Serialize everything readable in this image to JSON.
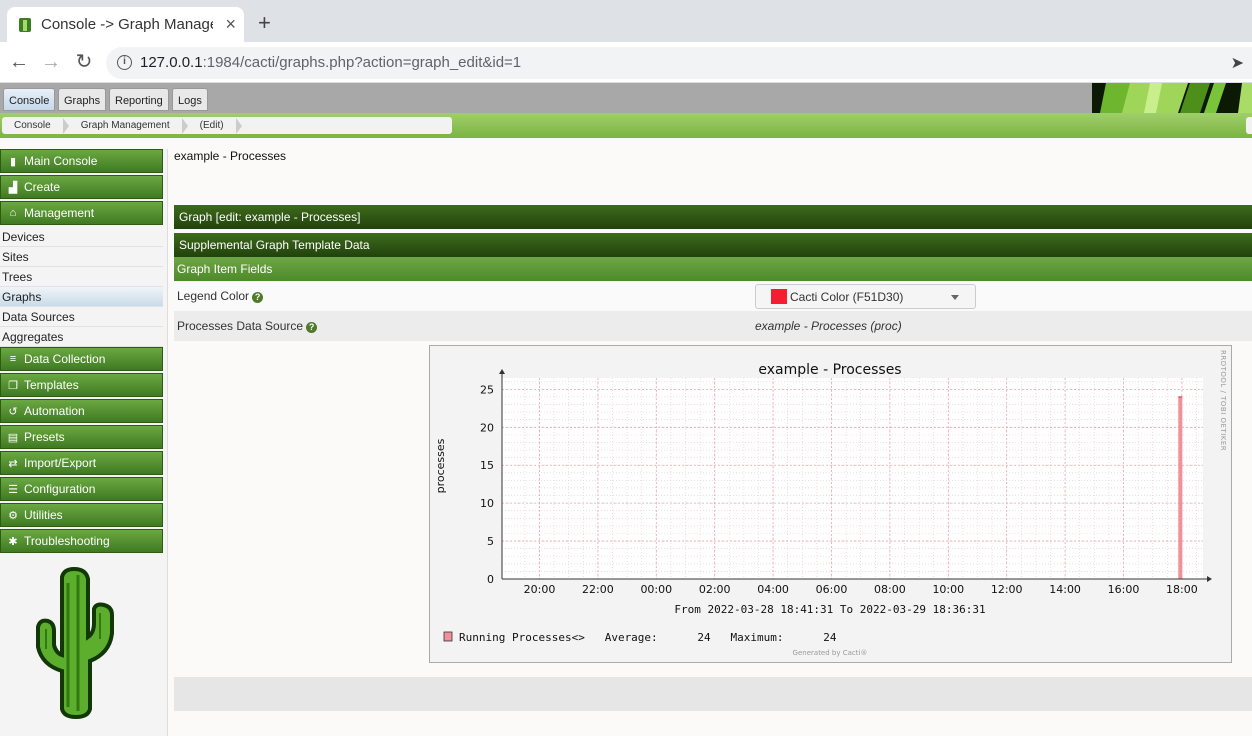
{
  "browser": {
    "tab_title": "Console -> Graph Management",
    "url_host": "127.0.0.1",
    "url_rest": ":1984/cacti/graphs.php?action=graph_edit&id=1"
  },
  "top_tabs": [
    "Console",
    "Graphs",
    "Reporting",
    "Logs"
  ],
  "breadcrumb": [
    "Console",
    "Graph Management",
    "(Edit)"
  ],
  "sidebar": {
    "main_console": "Main Console",
    "create": "Create",
    "management": "Management",
    "management_items": [
      "Devices",
      "Sites",
      "Trees",
      "Graphs",
      "Data Sources",
      "Aggregates"
    ],
    "sections": [
      {
        "label": "Data Collection",
        "icon": "database-icon"
      },
      {
        "label": "Templates",
        "icon": "copy-icon"
      },
      {
        "label": "Automation",
        "icon": "refresh-icon"
      },
      {
        "label": "Presets",
        "icon": "archive-icon"
      },
      {
        "label": "Import/Export",
        "icon": "exchange-icon"
      },
      {
        "label": "Configuration",
        "icon": "sliders-icon"
      },
      {
        "label": "Utilities",
        "icon": "cogs-icon"
      },
      {
        "label": "Troubleshooting",
        "icon": "bug-icon"
      }
    ]
  },
  "main": {
    "page_title": "example - Processes",
    "graph_header": "Graph [edit: example - Processes]",
    "supplemental_header": "Supplemental Graph Template Data",
    "item_fields_header": "Graph Item Fields",
    "legend_color_label": "Legend Color",
    "legend_color_value": "Cacti Color (F51D30)",
    "legend_color_hex": "#f51d30",
    "data_source_label": "Processes Data Source",
    "data_source_value": "example - Processes (proc)"
  },
  "chart_data": {
    "type": "bar",
    "title": "example - Processes",
    "ylabel": "processes",
    "ylim": [
      0,
      25
    ],
    "yticks": [
      0,
      5,
      10,
      15,
      20,
      25
    ],
    "xticks": [
      "20:00",
      "22:00",
      "00:00",
      "02:00",
      "04:00",
      "06:00",
      "08:00",
      "10:00",
      "12:00",
      "14:00",
      "16:00",
      "18:00"
    ],
    "period": "From 2022-03-28 18:41:31 To 2022-03-29 18:36:31",
    "series": [
      {
        "name": "Running Processes<>",
        "x": "2022-03-29 17:25",
        "value": 24
      }
    ],
    "legend_text": "Running Processes<>   Average:      24   Maximum:      24",
    "watermark": "RRDTOOL / TOBI OETIKER",
    "generated": "Generated by Cacti®",
    "series_color": "#f0909a"
  }
}
